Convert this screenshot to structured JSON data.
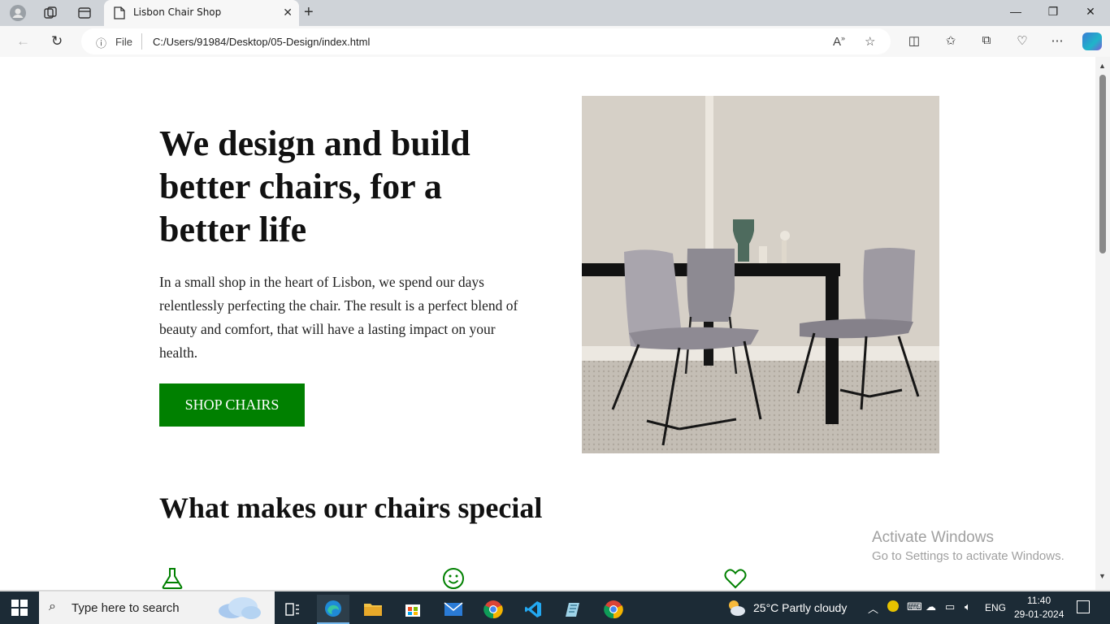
{
  "browser": {
    "tab_title": "Lisbon Chair Shop",
    "address_label": "File",
    "url": "C:/Users/91984/Desktop/05-Design/index.html"
  },
  "hero": {
    "title": "We design and build better chairs, for a better life",
    "text": "In a small shop in the heart of Lisbon, we spend our days relentlessly perfecting the chair. The result is a perfect blend of beauty and comfort, that will have a lasting impact on your health.",
    "cta_label": "SHOP CHAIRS"
  },
  "features": {
    "title": "What makes our chairs special",
    "icons": [
      "flask-icon",
      "smile-icon",
      "heart-icon"
    ]
  },
  "watermark": {
    "line1": "Activate Windows",
    "line2": "Go to Settings to activate Windows."
  },
  "taskbar": {
    "search_placeholder": "Type here to search",
    "weather": "25°C  Partly cloudy",
    "language": "ENG",
    "time": "11:40",
    "date": "29-01-2024"
  },
  "colors": {
    "accent": "#008000",
    "taskbar": "#1c2b36"
  }
}
